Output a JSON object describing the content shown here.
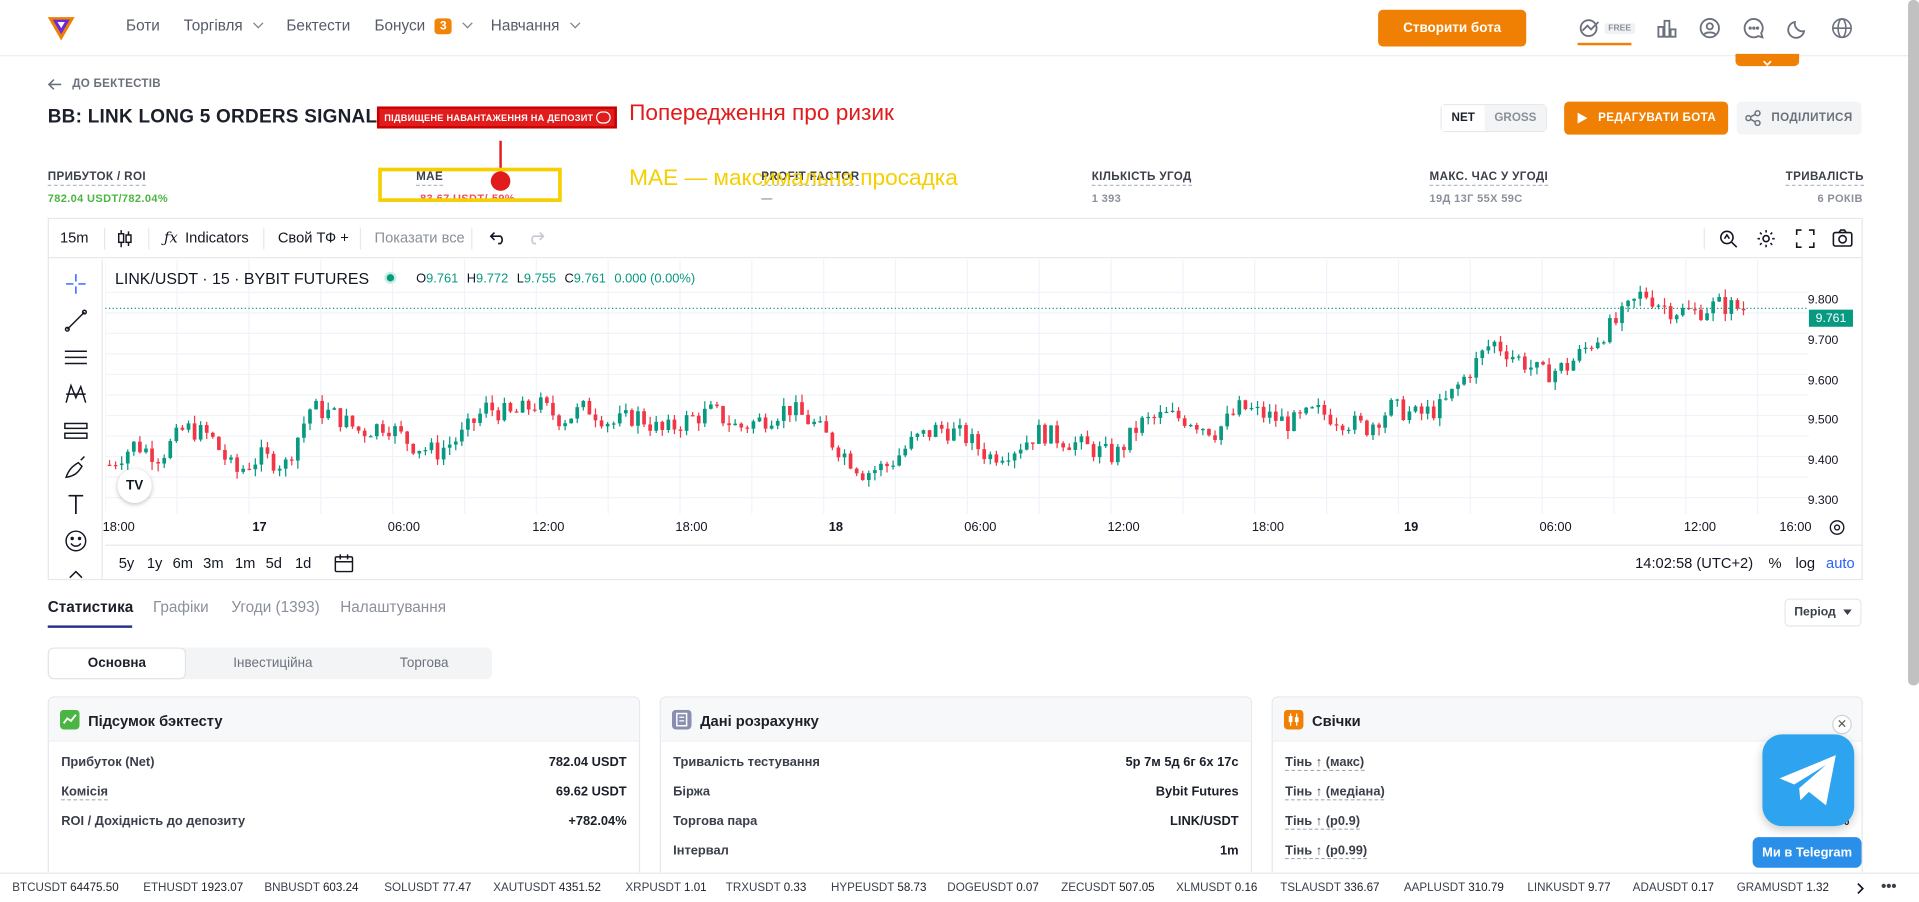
{
  "header": {
    "nav": [
      {
        "label": "Боти",
        "chevron": false
      },
      {
        "label": "Торгівля",
        "chevron": true
      },
      {
        "label": "Бектести",
        "chevron": false
      },
      {
        "label": "Бонуси",
        "chevron": true,
        "badge": "3"
      },
      {
        "label": "Навчання",
        "chevron": true
      }
    ],
    "cta": "Створити бота",
    "free_badge": "FREE",
    "icons": [
      "chart-growth-icon",
      "bar-chart-icon",
      "user-icon",
      "chat-icon",
      "moon-icon",
      "globe-icon"
    ]
  },
  "page": {
    "back": "ДО БЕКТЕСТІВ",
    "title": "BB: LINK LONG 5 ORDERS SIGNAL",
    "warning": "ПІДВИЩЕНЕ НАВАНТАЖЕННЯ НА ДЕПОЗИТ",
    "annotations": {
      "risk": "Попередження про ризик",
      "mae": "MAE — максимальна просадка"
    },
    "net": "NET",
    "gross": "GROSS",
    "edit": "РЕДАГУВАТИ БОТА",
    "share": "ПОДІЛИТИСЯ"
  },
  "stats": [
    {
      "label": "ПРИБУТОК / ROI",
      "value": "782.04 USDT/782.04%",
      "color": "#4bb543"
    },
    {
      "label": "MAE",
      "value": "-83.67 USDT/-59%",
      "color": "#e8545a"
    },
    {
      "label": "PROFIT FACTOR",
      "value": "—",
      "color": "#8a9099"
    },
    {
      "label": "КІЛЬКІСТЬ УГОД",
      "value": "1 393",
      "color": "#8a9099"
    },
    {
      "label": "МАКС. ЧАС У УГОДІ",
      "value": "19Д 13Г 55Х 59С",
      "color": "#8a9099"
    },
    {
      "label": "ТРИВАЛІСТЬ",
      "value": "6 РОКІВ",
      "color": "#8a9099"
    }
  ],
  "chart_toolbar": {
    "interval": "15m",
    "indicators": "Indicators",
    "custom_tf": "Свой ТФ +",
    "show_all": "Показати все"
  },
  "chart": {
    "symbol": "LINK/USDT · 15 · BYBIT FUTURES",
    "ohlc": {
      "O": "9.761",
      "H": "9.772",
      "L": "9.755",
      "C": "9.761",
      "change": "0.000 (0.00%)"
    },
    "last_price": "9.761",
    "y_ticks": [
      "9.800",
      "9.700",
      "9.600",
      "9.500",
      "9.400",
      "9.300"
    ],
    "x_ticks": [
      {
        "label": "18:00",
        "bold": false
      },
      {
        "label": "17",
        "bold": true
      },
      {
        "label": "06:00",
        "bold": false
      },
      {
        "label": "12:00",
        "bold": false
      },
      {
        "label": "18:00",
        "bold": false
      },
      {
        "label": "18",
        "bold": true
      },
      {
        "label": "06:00",
        "bold": false
      },
      {
        "label": "12:00",
        "bold": false
      },
      {
        "label": "18:00",
        "bold": false
      },
      {
        "label": "19",
        "bold": true
      },
      {
        "label": "06:00",
        "bold": false
      },
      {
        "label": "12:00",
        "bold": false
      },
      {
        "label": "16:00",
        "bold": false
      }
    ],
    "ranges": [
      "5y",
      "1y",
      "6m",
      "3m",
      "1m",
      "5d",
      "1d"
    ],
    "clock": "14:02:58 (UTC+2)",
    "pct": "%",
    "log": "log",
    "auto": "auto",
    "up_color": "#089981",
    "down_color": "#f23645"
  },
  "chart_data": {
    "type": "candlestick",
    "x_range": [
      "16 18:00",
      "19 16:00"
    ],
    "ylim": [
      9.26,
      9.88
    ],
    "trend": [
      9.38,
      9.43,
      9.4,
      9.47,
      9.45,
      9.36,
      9.4,
      9.38,
      9.52,
      9.5,
      9.46,
      9.48,
      9.43,
      9.41,
      9.45,
      9.52,
      9.5,
      9.53,
      9.49,
      9.52,
      9.48,
      9.5,
      9.46,
      9.49,
      9.51,
      9.47,
      9.49,
      9.52,
      9.48,
      9.42,
      9.36,
      9.38,
      9.44,
      9.47,
      9.45,
      9.4,
      9.42,
      9.46,
      9.44,
      9.42,
      9.4,
      9.48,
      9.5,
      9.49,
      9.46,
      9.52,
      9.5,
      9.48,
      9.51,
      9.49,
      9.47,
      9.52,
      9.5,
      9.52,
      9.6,
      9.68,
      9.64,
      9.6,
      9.62,
      9.68,
      9.73,
      9.8,
      9.76,
      9.75,
      9.77,
      9.76
    ]
  },
  "tabs": [
    "Статистика",
    "Графіки",
    "Угоди (1393)",
    "Налаштування"
  ],
  "period": "Період",
  "subtabs": [
    "Основна",
    "Інвестиційна",
    "Торгова"
  ],
  "cards": [
    {
      "title": "Підсумок бэктесту",
      "icon": "trend-icon",
      "color": "#4bb543",
      "rows": [
        {
          "k": "Прибуток (Net)",
          "v": "782.04 USDT",
          "u": false
        },
        {
          "k": "Комісія",
          "v": "69.62 USDT",
          "u": true
        },
        {
          "k": "ROI / Дохідність до депозиту",
          "v": "+782.04%",
          "u": false
        }
      ]
    },
    {
      "title": "Дані розрахунку",
      "icon": "document-icon",
      "color": "#8a8fb0",
      "rows": [
        {
          "k": "Тривалість тестування",
          "v": "5р 7м 5д 6г 6х 17с",
          "u": false
        },
        {
          "k": "Біржа",
          "v": "Bybit Futures",
          "u": false
        },
        {
          "k": "Торгова пара",
          "v": "LINK/USDT",
          "u": false
        },
        {
          "k": "Інтервал",
          "v": "1m",
          "u": false
        }
      ]
    },
    {
      "title": "Свічки",
      "icon": "candles-icon",
      "color": "#f08004",
      "rows": [
        {
          "k": "Тінь ↑ (макс)",
          "v": "",
          "u": true
        },
        {
          "k": "Тінь ↑ (медіана)",
          "v": "",
          "u": true
        },
        {
          "k": "Тінь ↑ (p0.9)",
          "v": "%",
          "u": true
        },
        {
          "k": "Тінь ↑ (p0.99)",
          "v": "",
          "u": true
        }
      ]
    }
  ],
  "telegram": "Ми в Telegram",
  "ticker": [
    {
      "s": "BTCUSDT",
      "p": "64475.50"
    },
    {
      "s": "ETHUSDT",
      "p": "1923.07"
    },
    {
      "s": "BNBUSDT",
      "p": "603.24"
    },
    {
      "s": "SOLUSDT",
      "p": "77.47"
    },
    {
      "s": "XAUTUSDT",
      "p": "4351.52"
    },
    {
      "s": "XRPUSDT",
      "p": "1.01"
    },
    {
      "s": "TRXUSDT",
      "p": "0.33"
    },
    {
      "s": "HYPEUSDT",
      "p": "58.73"
    },
    {
      "s": "DOGEUSDT",
      "p": "0.07"
    },
    {
      "s": "ZECUSDT",
      "p": "507.05"
    },
    {
      "s": "XLMUSDT",
      "p": "0.16"
    },
    {
      "s": "TSLAUSDT",
      "p": "336.67"
    },
    {
      "s": "AAPLUSDT",
      "p": "310.79"
    },
    {
      "s": "LINKUSDT",
      "p": "9.77"
    },
    {
      "s": "ADAUSDT",
      "p": "0.17"
    },
    {
      "s": "GRAMUSDT",
      "p": "1.32"
    }
  ]
}
